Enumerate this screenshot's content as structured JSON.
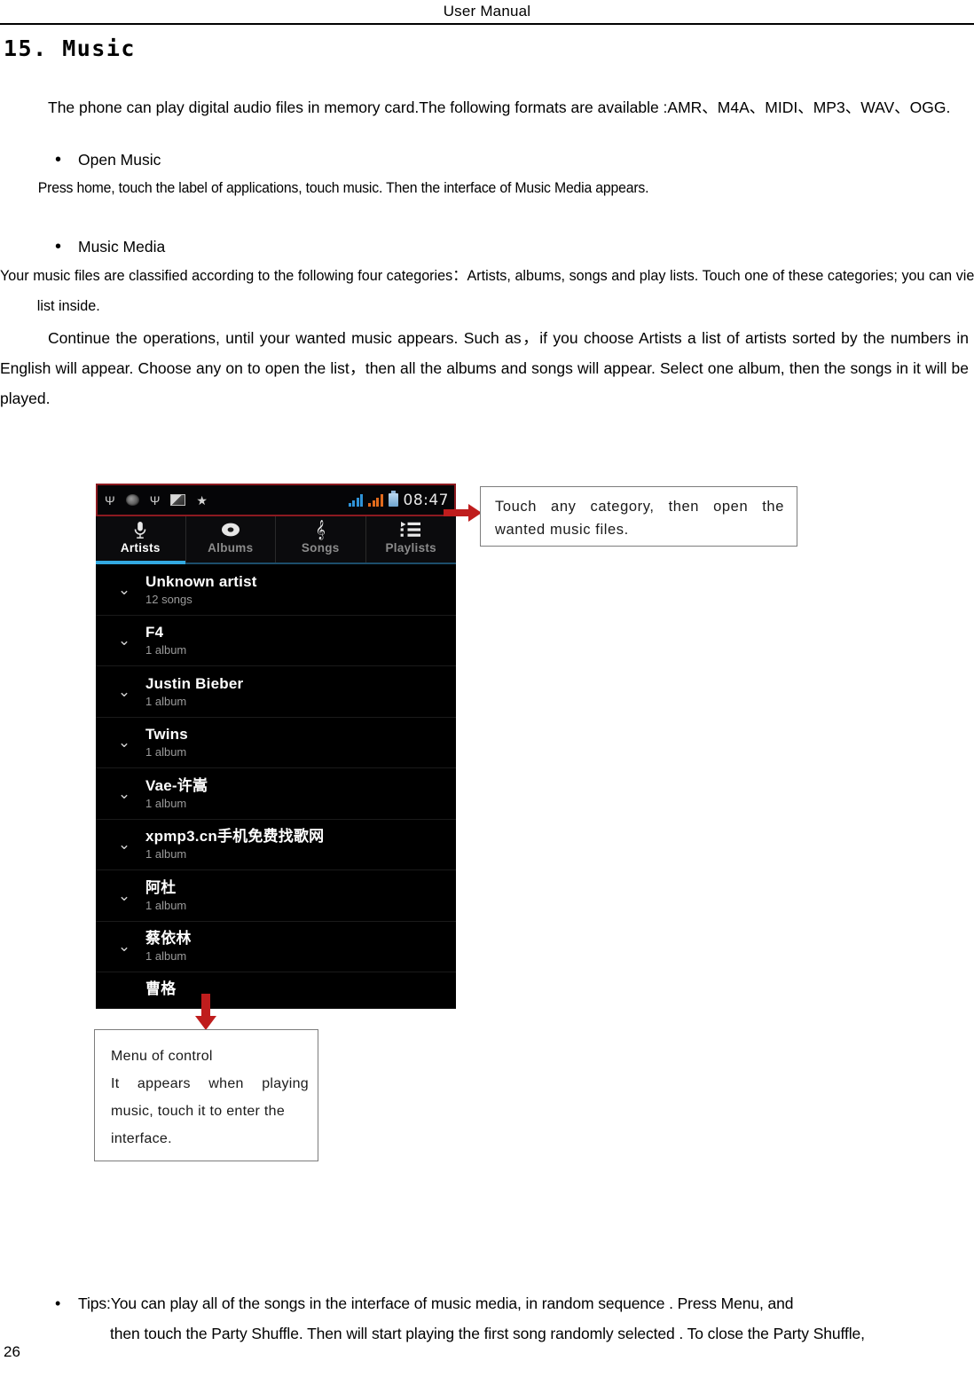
{
  "header": {
    "title": "User    Manual"
  },
  "section": {
    "number_title": "15. Music",
    "intro": "The    phone can play digital audio files in memory card.The following formats are available :AMR、M4A、MIDI、MP3、WAV、OGG."
  },
  "bullets": {
    "open_music": {
      "label": "Open Music",
      "body": "Press home, touch the label of applications, touch music. Then the interface of Music Media appears."
    },
    "music_media": {
      "label": "Music Media",
      "body1": "Your music files are classified according to the following four categories：Artists, albums, songs and play lists. Touch one of these categories; you can view the list inside.",
      "body2": "Continue the operations, until your wanted music appears. Such as，if you choose Artists a list of artists sorted by the numbers in English will appear. Choose any on to open the list，then all the albums and songs will appear. Select one album, then the songs in it will be played."
    },
    "tips": {
      "line1": "Tips:You can play all of the songs in the interface of    music media, in random sequence    . Press    Menu, and",
      "line2": "then touch the Party Shuffle. Then will start playing the first song randomly selected . To close the Party Shuffle,"
    }
  },
  "figure": {
    "phone": {
      "status_bar": {
        "icons": [
          "usb-icon",
          "disc-icon",
          "usb-icon",
          "sd-card-icon",
          "star-icon"
        ],
        "signal_primary": "signal-bars-icon",
        "signal_secondary": "signal-bars-icon",
        "battery": "battery-icon",
        "time": "08:47"
      },
      "tabs": [
        {
          "label": "Artists",
          "icon": "microphone-icon",
          "active": true
        },
        {
          "label": "Albums",
          "icon": "disc-icon",
          "active": false
        },
        {
          "label": "Songs",
          "icon": "treble-clef-icon",
          "active": false
        },
        {
          "label": "Playlists",
          "icon": "playlist-icon",
          "active": false
        }
      ],
      "artists": [
        {
          "name": "Unknown artist",
          "sub": "12 songs"
        },
        {
          "name": "F4",
          "sub": "1 album"
        },
        {
          "name": "Justin Bieber",
          "sub": "1 album"
        },
        {
          "name": "Twins",
          "sub": "1 album"
        },
        {
          "name": "Vae-许嵩",
          "sub": "1 album"
        },
        {
          "name": "xpmp3.cn手机免费找歌网",
          "sub": "1 album"
        },
        {
          "name": "阿杜",
          "sub": "1 album"
        },
        {
          "name": "蔡依林",
          "sub": "1 album"
        },
        {
          "name": "曹格",
          "sub": ""
        }
      ]
    },
    "callout_top": {
      "line1": "Touch any category, then open the",
      "line2": "wanted music files."
    },
    "callout_bottom": {
      "line1": "Menu of control",
      "line2": "It appears when playing",
      "line3": "music, touch it to enter the",
      "line4": "interface."
    },
    "arrow_color": "#bf1d1d"
  },
  "footer": {
    "page_number": "26"
  }
}
